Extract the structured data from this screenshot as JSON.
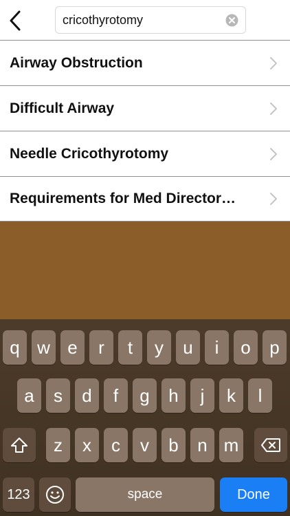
{
  "search": {
    "value": "cricothyrotomy"
  },
  "results": [
    {
      "label": "Airway Obstruction"
    },
    {
      "label": "Difficult Airway"
    },
    {
      "label": "Needle Cricothyrotomy"
    },
    {
      "label": "Requirements for Med Director…"
    }
  ],
  "keyboard": {
    "row1": [
      "q",
      "w",
      "e",
      "r",
      "t",
      "y",
      "u",
      "i",
      "o",
      "p"
    ],
    "row2": [
      "a",
      "s",
      "d",
      "f",
      "g",
      "h",
      "j",
      "k",
      "l"
    ],
    "row3": [
      "z",
      "x",
      "c",
      "v",
      "b",
      "n",
      "m"
    ],
    "numbers_label": "123",
    "space_label": "space",
    "done_label": "Done"
  },
  "colors": {
    "background_brown": "#8b5d29",
    "keyboard_bg": "#4d3b2a",
    "key": "#8a7666",
    "key_dark": "#5f4c3c",
    "done_blue": "#1a7ff4"
  },
  "icons": {
    "back": "chevron-left-icon",
    "clear": "clear-circle-icon",
    "row_chevron": "chevron-right-icon",
    "shift": "shift-icon",
    "delete": "delete-icon",
    "emoji": "emoji-icon"
  }
}
